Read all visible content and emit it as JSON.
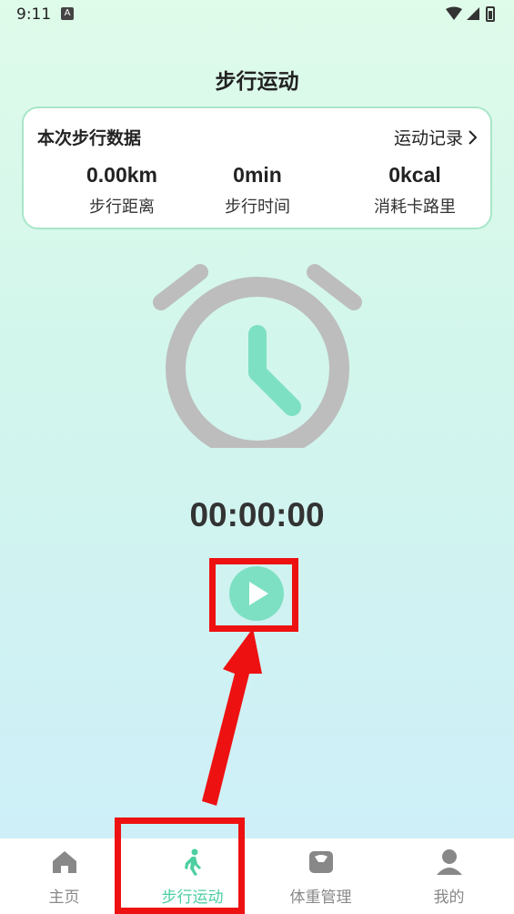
{
  "status_bar": {
    "time": "9:11",
    "notification_glyph": "A"
  },
  "page_title": "步行运动",
  "stats_card": {
    "title": "本次步行数据",
    "records_link": "运动记录",
    "stats": [
      {
        "value": "0.00km",
        "label": "步行距离"
      },
      {
        "value": "0min",
        "label": "步行时间"
      },
      {
        "value": "0kcal",
        "label": "消耗卡路里"
      }
    ]
  },
  "timer": "00:00:00",
  "tabs": [
    {
      "label": "主页",
      "icon": "home-icon",
      "active": false
    },
    {
      "label": "步行运动",
      "icon": "walking-icon",
      "active": true
    },
    {
      "label": "体重管理",
      "icon": "scale-icon",
      "active": false
    },
    {
      "label": "我的",
      "icon": "user-icon",
      "active": false
    }
  ],
  "colors": {
    "accent": "#4ccfa0",
    "play_button": "#7ee0c3",
    "clock_body": "#bdbdbd",
    "clock_hands": "#7ee0c3",
    "annotation": "#ee1111"
  }
}
